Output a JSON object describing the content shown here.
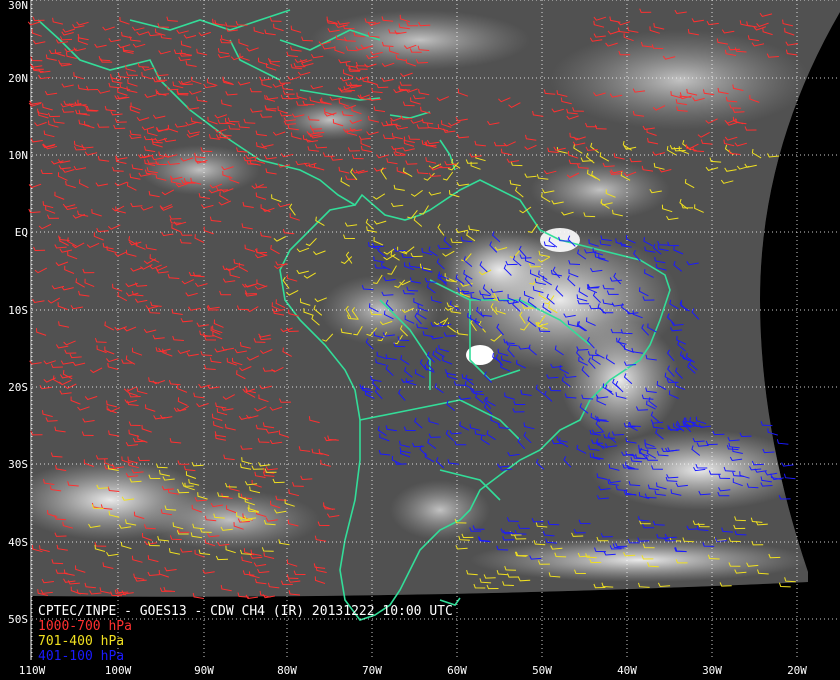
{
  "title": "CPTEC/INPE - GOES13 - CDW CH4 (IR) 20131222 10:00 UTC",
  "legend": [
    {
      "label": "1000-700 hPa",
      "color": "#ff3030"
    },
    {
      "label": "701-400 hPa",
      "color": "#f0e020"
    },
    {
      "label": "401-100 hPa",
      "color": "#1a1aff"
    }
  ],
  "lat_labels": [
    "30N",
    "20N",
    "10N",
    "EQ",
    "10S",
    "20S",
    "30S",
    "40S",
    "50S"
  ],
  "lon_labels": [
    "110W",
    "100W",
    "90W",
    "80W",
    "70W",
    "60W",
    "50W",
    "40W",
    "30W",
    "20W"
  ],
  "colors": {
    "coast": "#33dd99",
    "grid": "#ffffff",
    "background": "#000000",
    "text": "#ffffff"
  }
}
